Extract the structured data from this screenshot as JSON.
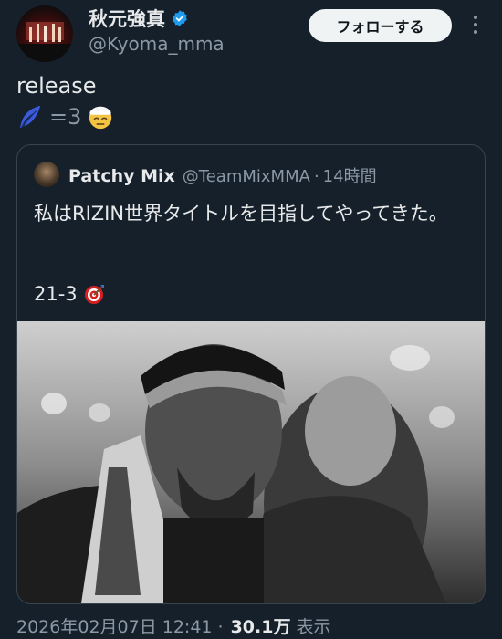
{
  "user": {
    "display_name": "秋元強真",
    "handle": "@Kyoma_mma",
    "verified": true
  },
  "header": {
    "follow_label": "フォローする",
    "more_icon": "more-dots-icon"
  },
  "tweet": {
    "text": "release",
    "emoji_sequence": [
      "feather-icon",
      "=3",
      "bandaged-face-icon"
    ]
  },
  "quote": {
    "display_name": "Patchy Mix",
    "handle": "@TeamMixMMA",
    "separator": "·",
    "time": "14時間",
    "text": "私はRIZIN世界タイトルを目指してやってきた。",
    "record": "21-3",
    "record_icon": "target-icon"
  },
  "meta": {
    "timestamp": "2026年02月07日 12:41",
    "separator": "·",
    "views": "30.1万",
    "views_label": "表示"
  },
  "colors": {
    "background": "#15202b",
    "text": "#e7e9ea",
    "secondary": "#8b98a5",
    "border": "#38444d",
    "verified": "#1d9bf0"
  }
}
